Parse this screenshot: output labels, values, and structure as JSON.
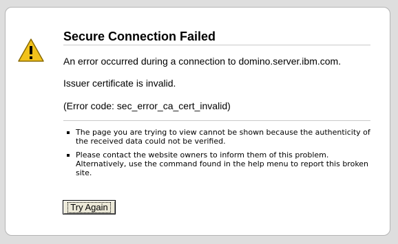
{
  "error_page": {
    "title": "Secure Connection Failed",
    "messages": [
      "An error occurred during a connection to domino.server.ibm.com.",
      "Issuer certificate is invalid.",
      "(Error code: sec_error_ca_cert_invalid)"
    ],
    "bullets": [
      "The page you are trying to view cannot be shown because the authenticity of the received data could not be verified.",
      "Please contact the website owners to inform them of this problem. Alternatively, use the command found in the help menu to report this broken site."
    ],
    "try_again_label": "Try Again",
    "icon": "warning-triangle-icon",
    "colors": {
      "warning_yellow": "#f2c21b",
      "panel_border": "#b3b3b3",
      "background": "#dedede"
    }
  }
}
